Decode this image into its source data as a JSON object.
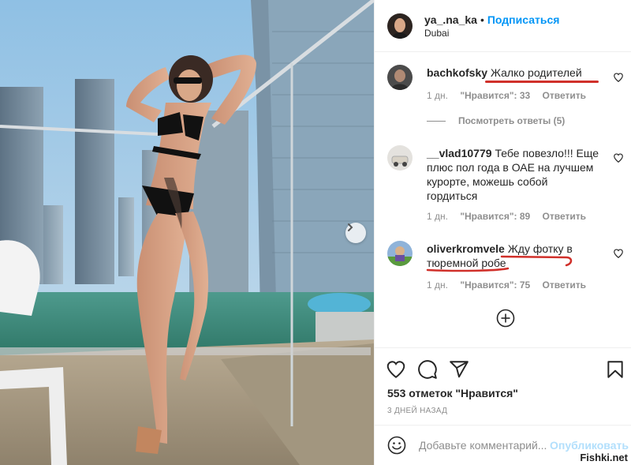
{
  "post": {
    "username": "ya_.na_ka",
    "separator": "•",
    "follow_label": "Подписаться",
    "location": "Dubai"
  },
  "comments": [
    {
      "user": "bachkofsky",
      "text": "Жалко родителей",
      "time": "1 дн.",
      "likes": "\"Нравится\": 33",
      "reply": "Ответить"
    },
    {
      "user": "__vlad10779",
      "text": "Тебе повезло!!! Еще плюс пол года в ОАЕ на лучшем курорте, можешь собой гордиться",
      "time": "1 дн.",
      "likes": "\"Нравится\": 89",
      "reply": "Ответить"
    },
    {
      "user": "oliverkromvele",
      "text": "Жду фотку в тюремной робе",
      "time": "1 дн.",
      "likes": "\"Нравится\": 75",
      "reply": "Ответить"
    }
  ],
  "view_replies": "Посмотреть ответы (5)",
  "likes_total": "553 отметок \"Нравится\"",
  "posted_ago": "3 ДНЕЙ НАЗАД",
  "comment_box": {
    "placeholder": "Добавьте комментарий...",
    "publish_label": "Опубликовать"
  },
  "watermark": "Fishki.net",
  "icons": [
    "chevron-right-icon",
    "heart-icon",
    "comment-icon",
    "share-icon",
    "bookmark-icon",
    "plus-circle-icon",
    "emoji-icon"
  ],
  "colors": {
    "accent": "#0095f6",
    "publish_disabled": "#b2dffc",
    "annotation_red": "#d0302a"
  }
}
